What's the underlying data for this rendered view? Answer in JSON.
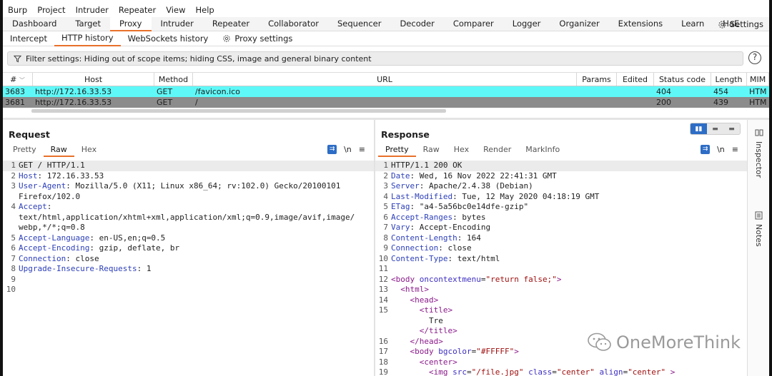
{
  "menu": [
    "Burp",
    "Project",
    "Intruder",
    "Repeater",
    "View",
    "Help"
  ],
  "main_tabs": [
    "Dashboard",
    "Target",
    "Proxy",
    "Intruder",
    "Repeater",
    "Collaborator",
    "Sequencer",
    "Decoder",
    "Comparer",
    "Logger",
    "Organizer",
    "Extensions",
    "Learn",
    "HaE"
  ],
  "main_active": "Proxy",
  "settings_label": "Settings",
  "sub_tabs": [
    "Intercept",
    "HTTP history",
    "WebSockets history",
    "Proxy settings"
  ],
  "filter_text": "Filter settings: Hiding out of scope items;  hiding CSS, image and general binary content",
  "help_label": "?",
  "columns": [
    "#",
    "Host",
    "Method",
    "URL",
    "Params",
    "Edited",
    "Status code",
    "Length",
    "MIM"
  ],
  "rows": [
    {
      "id": "3683",
      "host": "http://172.16.33.53",
      "method": "GET",
      "url": "/favicon.ico",
      "params": "",
      "edited": "",
      "status": "404",
      "length": "454",
      "mime": "HTM"
    },
    {
      "id": "3681",
      "host": "http://172.16.33.53",
      "method": "GET",
      "url": "/",
      "params": "",
      "edited": "",
      "status": "200",
      "length": "439",
      "mime": "HTM"
    }
  ],
  "request": {
    "title": "Request",
    "tabs": [
      "Pretty",
      "Raw",
      "Hex"
    ],
    "active": "Raw",
    "lines": [
      {
        "n": "1",
        "segs": [
          {
            "t": "GET / HTTP/1.1",
            "c": ""
          }
        ]
      },
      {
        "n": "2",
        "segs": [
          {
            "t": "Host",
            "c": "k"
          },
          {
            "t": ": 172.16.33.53",
            "c": ""
          }
        ]
      },
      {
        "n": "3",
        "segs": [
          {
            "t": "User-Agent",
            "c": "k"
          },
          {
            "t": ": Mozilla/5.0 (X11; Linux x86_64; rv:102.0) Gecko/20100101",
            "c": ""
          }
        ]
      },
      {
        "n": "",
        "segs": [
          {
            "t": "Firefox/102.0",
            "c": ""
          }
        ]
      },
      {
        "n": "4",
        "segs": [
          {
            "t": "Accept",
            "c": "k"
          },
          {
            "t": ":",
            "c": ""
          }
        ]
      },
      {
        "n": "",
        "segs": [
          {
            "t": "text/html,application/xhtml+xml,application/xml;q=0.9,image/avif,image/",
            "c": ""
          }
        ]
      },
      {
        "n": "",
        "segs": [
          {
            "t": "webp,*/*;q=0.8",
            "c": ""
          }
        ]
      },
      {
        "n": "5",
        "segs": [
          {
            "t": "Accept-Language",
            "c": "k"
          },
          {
            "t": ": en-US,en;q=0.5",
            "c": ""
          }
        ]
      },
      {
        "n": "6",
        "segs": [
          {
            "t": "Accept-Encoding",
            "c": "k"
          },
          {
            "t": ": gzip, deflate, br",
            "c": ""
          }
        ]
      },
      {
        "n": "7",
        "segs": [
          {
            "t": "Connection",
            "c": "k"
          },
          {
            "t": ": close",
            "c": ""
          }
        ]
      },
      {
        "n": "8",
        "segs": [
          {
            "t": "Upgrade-Insecure-Requests",
            "c": "k"
          },
          {
            "t": ": 1",
            "c": ""
          }
        ]
      },
      {
        "n": "9",
        "segs": []
      },
      {
        "n": "10",
        "segs": []
      }
    ]
  },
  "response": {
    "title": "Response",
    "tabs": [
      "Pretty",
      "Raw",
      "Hex",
      "Render",
      "MarkInfo"
    ],
    "active": "Pretty",
    "lines": [
      {
        "n": "1",
        "segs": [
          {
            "t": "HTTP/1.1 200 OK",
            "c": ""
          }
        ]
      },
      {
        "n": "2",
        "segs": [
          {
            "t": "Date",
            "c": "k"
          },
          {
            "t": ": Wed, 16 Nov 2022 22:41:31 GMT",
            "c": ""
          }
        ]
      },
      {
        "n": "3",
        "segs": [
          {
            "t": "Server",
            "c": "k"
          },
          {
            "t": ": Apache/2.4.38 (Debian)",
            "c": ""
          }
        ]
      },
      {
        "n": "4",
        "segs": [
          {
            "t": "Last-Modified",
            "c": "k"
          },
          {
            "t": ": Tue, 12 May 2020 04:18:19 GMT",
            "c": ""
          }
        ]
      },
      {
        "n": "5",
        "segs": [
          {
            "t": "ETag",
            "c": "k"
          },
          {
            "t": ": \"a4-5a56bc0e14dfe-gzip\"",
            "c": ""
          }
        ]
      },
      {
        "n": "6",
        "segs": [
          {
            "t": "Accept-Ranges",
            "c": "k"
          },
          {
            "t": ": bytes",
            "c": ""
          }
        ]
      },
      {
        "n": "7",
        "segs": [
          {
            "t": "Vary",
            "c": "k"
          },
          {
            "t": ": Accept-Encoding",
            "c": ""
          }
        ]
      },
      {
        "n": "8",
        "segs": [
          {
            "t": "Content-Length",
            "c": "k"
          },
          {
            "t": ": 164",
            "c": ""
          }
        ]
      },
      {
        "n": "9",
        "segs": [
          {
            "t": "Connection",
            "c": "k"
          },
          {
            "t": ": close",
            "c": ""
          }
        ]
      },
      {
        "n": "10",
        "segs": [
          {
            "t": "Content-Type",
            "c": "k"
          },
          {
            "t": ": text/html",
            "c": ""
          }
        ]
      },
      {
        "n": "11",
        "segs": []
      },
      {
        "n": "12",
        "segs": [
          {
            "t": "<body ",
            "c": "tag"
          },
          {
            "t": "oncontextmenu",
            "c": "attr"
          },
          {
            "t": "=",
            "c": ""
          },
          {
            "t": "\"return false;\"",
            "c": "val"
          },
          {
            "t": ">",
            "c": "tag"
          }
        ]
      },
      {
        "n": "13",
        "segs": [
          {
            "t": "  <html>",
            "c": "tag"
          }
        ]
      },
      {
        "n": "14",
        "segs": [
          {
            "t": "    <head>",
            "c": "tag"
          }
        ]
      },
      {
        "n": "15",
        "segs": [
          {
            "t": "      <title>",
            "c": "tag"
          }
        ]
      },
      {
        "n": "",
        "segs": [
          {
            "t": "        Tre",
            "c": ""
          }
        ]
      },
      {
        "n": "",
        "segs": [
          {
            "t": "      </title>",
            "c": "tag"
          }
        ]
      },
      {
        "n": "16",
        "segs": [
          {
            "t": "    </head>",
            "c": "tag"
          }
        ]
      },
      {
        "n": "17",
        "segs": [
          {
            "t": "    <body ",
            "c": "tag"
          },
          {
            "t": "bgcolor",
            "c": "attr"
          },
          {
            "t": "=",
            "c": ""
          },
          {
            "t": "\"#FFFFF\"",
            "c": "val"
          },
          {
            "t": ">",
            "c": "tag"
          }
        ]
      },
      {
        "n": "18",
        "segs": [
          {
            "t": "      <center>",
            "c": "tag"
          }
        ]
      },
      {
        "n": "19",
        "segs": [
          {
            "t": "        <img ",
            "c": "tag"
          },
          {
            "t": "src",
            "c": "attr"
          },
          {
            "t": "=",
            "c": ""
          },
          {
            "t": "\"/file.jpg\"",
            "c": "val"
          },
          {
            "t": " ",
            "c": ""
          },
          {
            "t": "class",
            "c": "attr"
          },
          {
            "t": "=",
            "c": ""
          },
          {
            "t": "\"center\"",
            "c": "val"
          },
          {
            "t": " ",
            "c": ""
          },
          {
            "t": "align",
            "c": "attr"
          },
          {
            "t": "=",
            "c": ""
          },
          {
            "t": "\"center\"",
            "c": "val"
          },
          {
            "t": " >",
            "c": "tag"
          }
        ]
      }
    ]
  },
  "sidebar": [
    "Inspector",
    "Notes"
  ],
  "watermark": "OneMoreThink",
  "colors": {
    "accent": "#e8702a",
    "row_highlight": "#5ff8f8",
    "row_selected": "#8c8c8c",
    "active_button": "#2d6dc6"
  }
}
